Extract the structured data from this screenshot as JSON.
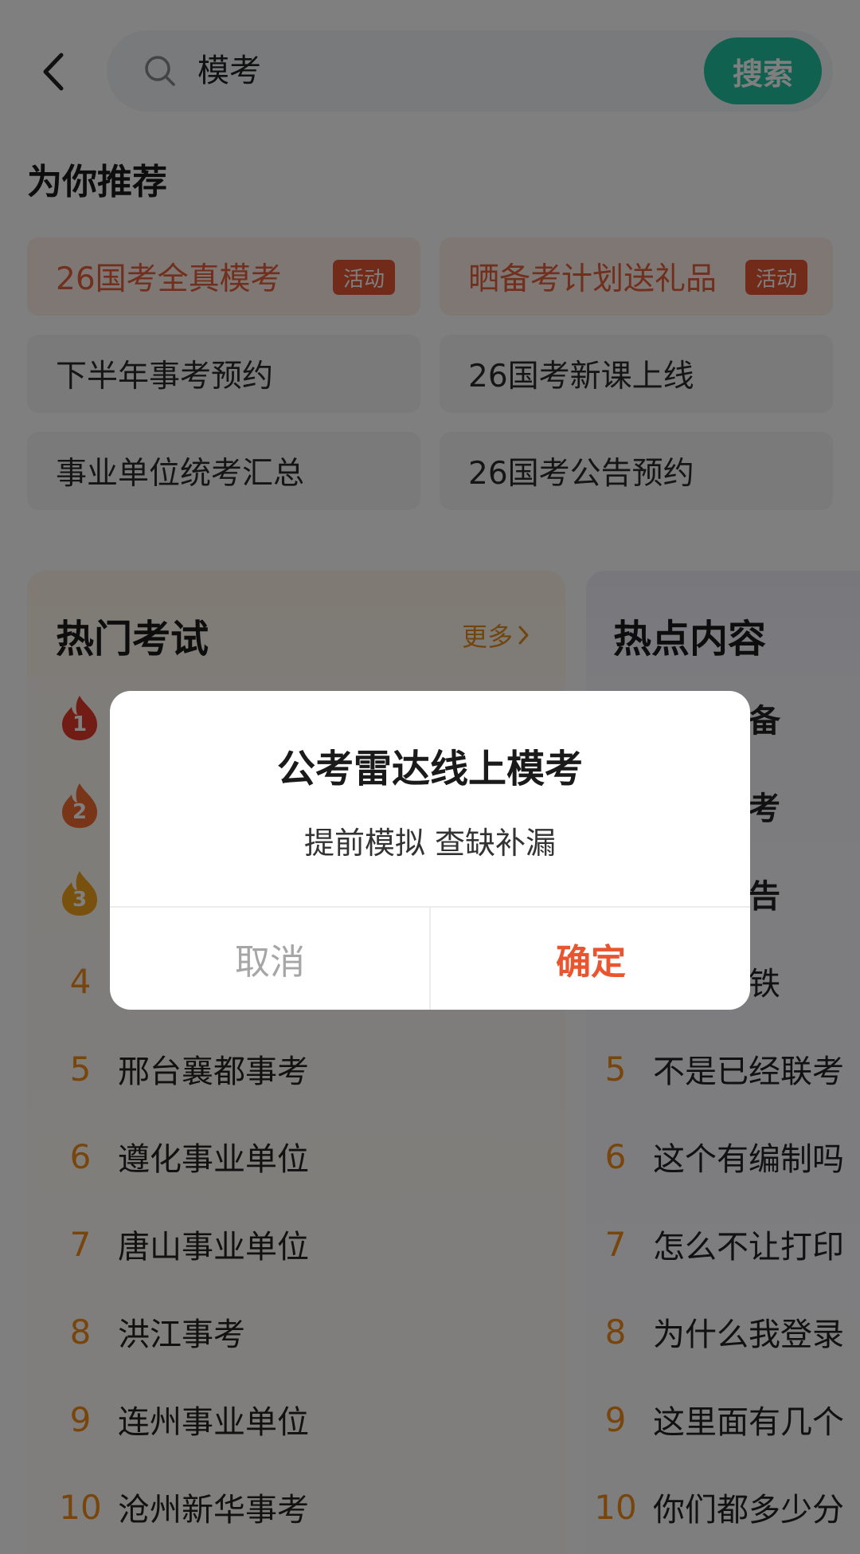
{
  "search": {
    "value": "模考",
    "button_label": "搜索"
  },
  "recommend": {
    "title": "为你推荐",
    "items": [
      {
        "label": "26国考全真模考",
        "badge": "活动"
      },
      {
        "label": "晒备考计划送礼品",
        "badge": "活动"
      },
      {
        "label": "下半年事考预约"
      },
      {
        "label": "26国考新课上线"
      },
      {
        "label": "事业单位统考汇总"
      },
      {
        "label": "26国考公告预约"
      }
    ]
  },
  "hot_exams": {
    "title": "热门考试",
    "more_label": "更多",
    "items": [
      {
        "rank": "1",
        "label": ""
      },
      {
        "rank": "2",
        "label": ""
      },
      {
        "rank": "3",
        "label": ""
      },
      {
        "rank": "4",
        "label": ""
      },
      {
        "rank": "5",
        "label": "邢台襄都事考"
      },
      {
        "rank": "6",
        "label": "遵化事业单位"
      },
      {
        "rank": "7",
        "label": "唐山事业单位"
      },
      {
        "rank": "8",
        "label": "洪江事考"
      },
      {
        "rank": "9",
        "label": "连州事业单位"
      },
      {
        "rank": "10",
        "label": "沧州新华事考"
      }
    ]
  },
  "hot_content": {
    "title": "热点内容",
    "items": [
      {
        "rank": "",
        "label": "是在职备"
      },
      {
        "rank": "",
        "label": "不是都考"
      },
      {
        "rank": "",
        "label": "联考公告"
      },
      {
        "rank": "",
        "label": "山连高铁"
      },
      {
        "rank": "5",
        "label": "不是已经联考"
      },
      {
        "rank": "6",
        "label": "这个有编制吗"
      },
      {
        "rank": "7",
        "label": "怎么不让打印"
      },
      {
        "rank": "8",
        "label": "为什么我登录"
      },
      {
        "rank": "9",
        "label": "这里面有几个"
      },
      {
        "rank": "10",
        "label": "你们都多少分"
      }
    ]
  },
  "dialog": {
    "title": "公考雷达线上模考",
    "message": "提前模拟 查缺补漏",
    "cancel_label": "取消",
    "confirm_label": "确定"
  },
  "colors": {
    "accent_green": "#22c3a2",
    "accent_orange": "#e55733",
    "rank_orange": "#f08a19",
    "confirm_red": "#e8552f"
  }
}
